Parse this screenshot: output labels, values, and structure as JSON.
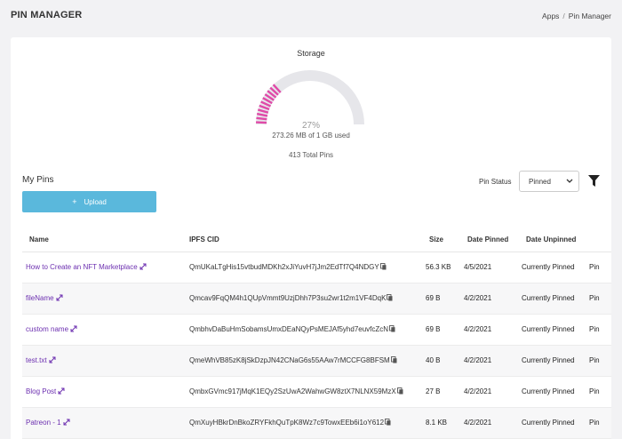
{
  "header": {
    "title": "PIN MANAGER",
    "breadcrumb": [
      "Apps",
      "Pin Manager"
    ]
  },
  "storage": {
    "title": "Storage",
    "percent_label": "27%",
    "percent_value": 27,
    "used_label": "273.26 MB of 1 GB used",
    "total_pins": "413 Total Pins",
    "accent_color": "#e04aa8",
    "track_color": "#e6e6ea"
  },
  "pins": {
    "title": "My Pins",
    "upload_label": "Upload",
    "upload_icon": "plus-icon",
    "status_label": "Pin Status",
    "status_selected": "Pinned",
    "filter_icon": "filter-icon",
    "columns": [
      "Name",
      "IPFS CID",
      "Size",
      "Date Pinned",
      "Date Unpinned"
    ],
    "rows": [
      {
        "name": "How to Create an NFT Marketplace",
        "cid": "QmUKaLTgHis15vtbudMDKh2xJiYuvH7jJm2EdTf7Q4NDGY",
        "size": "56.3 KB",
        "date_pinned": "4/5/2021",
        "date_unpinned": "Currently Pinned",
        "extra": "Pin"
      },
      {
        "name": "fileName",
        "cid": "Qmcav9FqQM4h1QUpVmmt9UzjDhh7P3su2wr1t2m1VF4DqK",
        "size": "69 B",
        "date_pinned": "4/2/2021",
        "date_unpinned": "Currently Pinned",
        "extra": "Pin"
      },
      {
        "name": "custom name",
        "cid": "QmbhvDaBuHmSobamsUmxDEaNQyPsMEJAf5yhd7euvfcZcN",
        "size": "69 B",
        "date_pinned": "4/2/2021",
        "date_unpinned": "Currently Pinned",
        "extra": "Pin"
      },
      {
        "name": "test.txt",
        "cid": "QmeWhVB85zK8jSkDzpJN42CNaG6s55AAw7rMCCFG8BFSM",
        "size": "40 B",
        "date_pinned": "4/2/2021",
        "date_unpinned": "Currently Pinned",
        "extra": "Pin"
      },
      {
        "name": "Blog Post",
        "cid": "QmbxGVmc917jMqK1EQy2SzUwA2WahwGW8ztX7NLNX59MzX",
        "size": "27 B",
        "date_pinned": "4/2/2021",
        "date_unpinned": "Currently Pinned",
        "extra": "Pin"
      },
      {
        "name": "Patreon - 1",
        "cid": "QmXuyHBkrDnBkoZRYFkhQuTpK8Wz7c9TowxEEb6i1oY612",
        "size": "8.1 KB",
        "date_pinned": "4/2/2021",
        "date_unpinned": "Currently Pinned",
        "extra": "Pin"
      }
    ]
  }
}
